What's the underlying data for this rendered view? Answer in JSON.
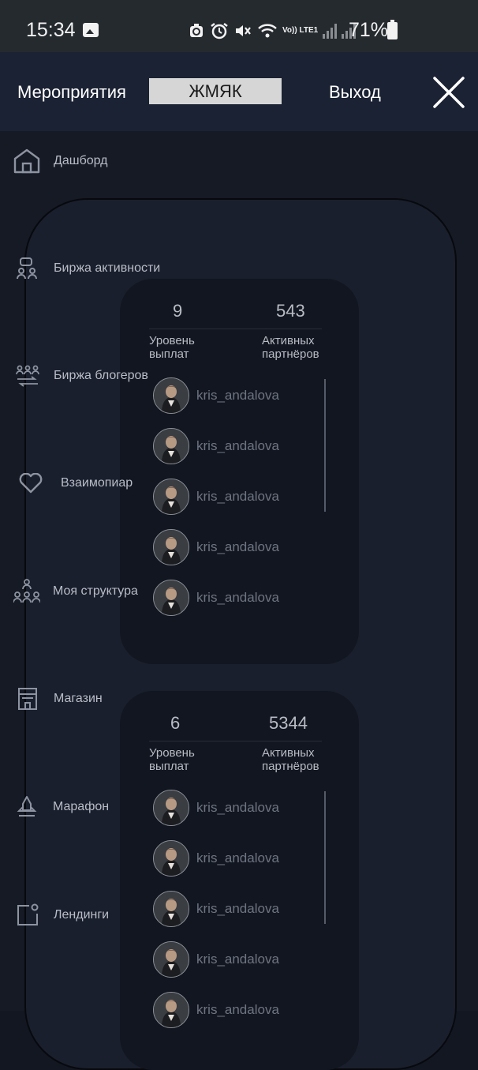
{
  "status_bar": {
    "time": "15:34",
    "icons": [
      "gallery-icon",
      "data-saver-icon",
      "alarm-icon",
      "mute-icon",
      "wifi-icon",
      "volte-icon",
      "signal-icon",
      "signal-icon"
    ],
    "volte_label": "Vo)) LTE1",
    "battery": "71%"
  },
  "header": {
    "events_label": "Мероприятия",
    "field_value": "ЖМЯК",
    "logout_label": "Выход",
    "close_icon": "close-icon"
  },
  "sidebar": {
    "items": [
      {
        "label": "Дашборд",
        "icon": "home-icon"
      },
      {
        "label": "Биржа активности",
        "icon": "activity-exchange-icon"
      },
      {
        "label": "Биржа блогеров",
        "icon": "bloggers-exchange-icon"
      },
      {
        "label": "Взаимопиар",
        "icon": "heart-icon"
      },
      {
        "label": "Моя структура",
        "icon": "structure-icon"
      },
      {
        "label": "Магазин",
        "icon": "store-icon"
      },
      {
        "label": "Марафон",
        "icon": "marathon-icon"
      },
      {
        "label": "Лендинги",
        "icon": "landing-icon"
      }
    ]
  },
  "cards": [
    {
      "level_value": "9",
      "partners_value": "543",
      "level_label": "Уровень выплат",
      "partners_label": "Активных партнёров",
      "users": [
        "kris_andalova",
        "kris_andalova",
        "kris_andalova",
        "kris_andalova",
        "kris_andalova"
      ]
    },
    {
      "level_value": "6",
      "partners_value": "5344",
      "level_label": "Уровень выплат",
      "partners_label": "Активных партнёров",
      "users": [
        "kris_andalova",
        "kris_andalova",
        "kris_andalova",
        "kris_andalova",
        "kris_andalova"
      ]
    }
  ]
}
